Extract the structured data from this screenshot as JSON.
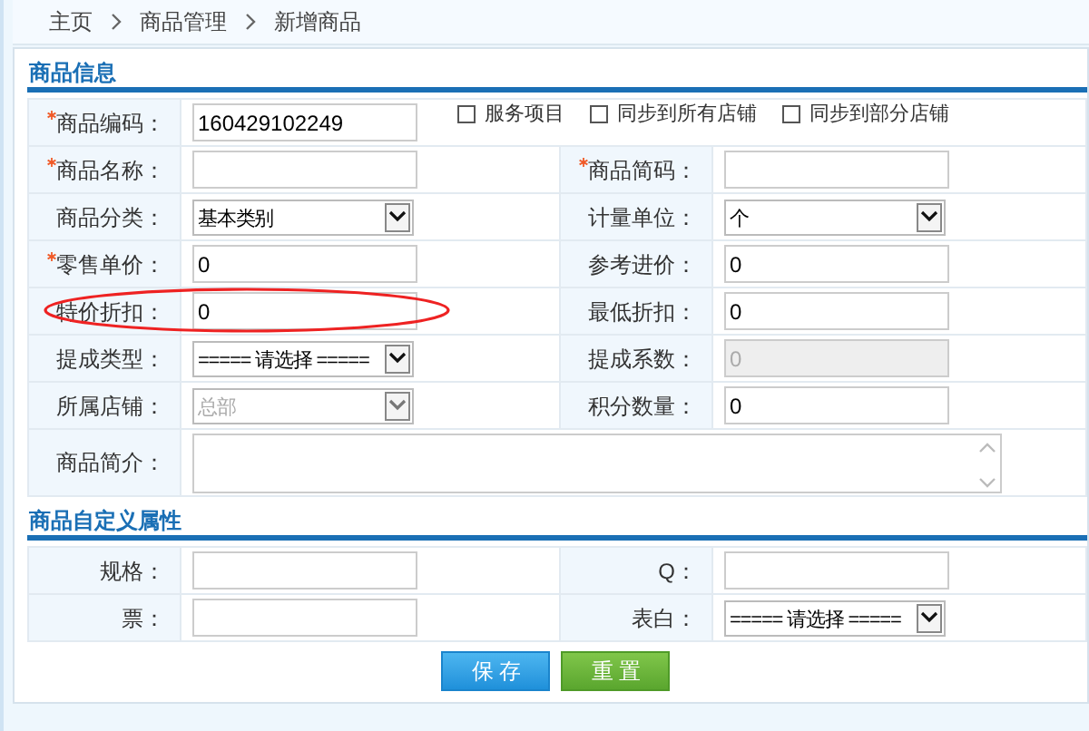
{
  "breadcrumb": [
    "主页",
    "商品管理",
    "新增商品"
  ],
  "sections": [
    {
      "title": "商品信息",
      "rows": [
        [
          {
            "kind": "input",
            "label": "商品编码：",
            "required": true,
            "value": "160429102249"
          },
          {
            "kind": "checkboxes",
            "items": [
              {
                "label": "服务项目",
                "checked": false
              },
              {
                "label": "同步到所有店铺",
                "checked": false
              },
              {
                "label": "同步到部分店铺",
                "checked": false
              }
            ]
          }
        ],
        [
          {
            "kind": "input",
            "label": "商品名称：",
            "required": true
          },
          {
            "kind": "input",
            "label": "商品简码：",
            "required": true
          }
        ],
        [
          {
            "kind": "select",
            "label": "商品分类：",
            "value": "基本类别"
          },
          {
            "kind": "select",
            "label": "计量单位：",
            "value": "个"
          }
        ],
        [
          {
            "kind": "input",
            "label": "零售单价：",
            "required": true,
            "value": "0"
          },
          {
            "kind": "input",
            "label": "参考进价：",
            "value": "0"
          }
        ],
        [
          {
            "kind": "input",
            "label": "特价折扣：",
            "value": "0",
            "circled": true
          },
          {
            "kind": "input",
            "label": "最低折扣：",
            "value": "0"
          }
        ],
        [
          {
            "kind": "select",
            "label": "提成类型：",
            "value": "===== 请选择 ====="
          },
          {
            "kind": "input",
            "label": "提成系数：",
            "value": "0",
            "disabled": true
          }
        ],
        [
          {
            "kind": "select",
            "label": "所属店铺：",
            "value": "总部",
            "disabled": true
          },
          {
            "kind": "input",
            "label": "积分数量：",
            "value": "0"
          }
        ],
        [
          {
            "kind": "textarea",
            "label": "商品简介："
          }
        ]
      ]
    },
    {
      "title": "商品自定义属性",
      "rows": [
        [
          {
            "kind": "input",
            "label": "规格："
          },
          {
            "kind": "input",
            "label": "Q："
          }
        ],
        [
          {
            "kind": "input",
            "label": "票："
          },
          {
            "kind": "select",
            "label": "表白：",
            "value": "===== 请选择 ====="
          }
        ]
      ]
    }
  ],
  "buttons": [
    {
      "label": "保 存",
      "kind": "primary"
    },
    {
      "label": "重 置",
      "kind": "secondary"
    }
  ]
}
